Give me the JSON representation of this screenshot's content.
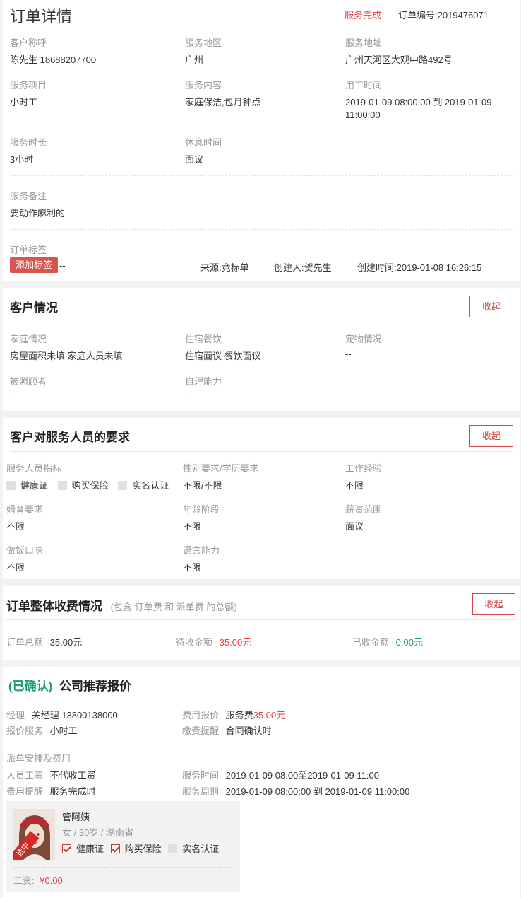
{
  "order": {
    "page_title": "订单详情",
    "status": "服务完成",
    "order_no_label": "订单编号:",
    "order_no": "2019476071",
    "fields": {
      "customer_name": {
        "label": "客户称呼",
        "value": "陈先生 18688207700"
      },
      "service_area": {
        "label": "服务地区",
        "value": "广州"
      },
      "service_address": {
        "label": "服务地址",
        "value": "广州天河区大观中路492号"
      },
      "service_item": {
        "label": "服务项目",
        "value": "小时工"
      },
      "service_content": {
        "label": "服务内容",
        "value": "家庭保洁,包月钟点"
      },
      "work_time": {
        "label": "用工时间",
        "value_line1": "2019-01-09 08:00:00 到 2019-01-09",
        "value_line2": "11:00:00"
      },
      "duration": {
        "label": "服务时长",
        "value": "3小时"
      },
      "rest_time": {
        "label": "休息时间",
        "value": "面议"
      },
      "remark": {
        "label": "服务备注",
        "value": "要动作麻利的"
      },
      "tag": {
        "label": "订单标签",
        "button": "添加标签",
        "value": "--"
      }
    },
    "source_label": "来源:",
    "source": "竞标单",
    "creator_label": "创建人:",
    "creator": "贺先生",
    "created_label": "创建时间:",
    "created": "2019-01-08 16:26:15"
  },
  "customer": {
    "title": "客户情况",
    "collapse": "收起",
    "family": {
      "label": "家庭情况",
      "value": "房屋面积未填 家庭人员未填"
    },
    "lodging": {
      "label": "住宿餐饮",
      "value": "住宿面议 餐饮面议"
    },
    "pets": {
      "label": "宠物情况",
      "value": "--"
    },
    "cared": {
      "label": "被照顾者",
      "value": "--"
    },
    "self_care": {
      "label": "自理能力",
      "value": "--"
    }
  },
  "requirements": {
    "title": "客户对服务人员的要求",
    "collapse": "收起",
    "indicators": {
      "label": "服务人员指标",
      "items": [
        "健康证",
        "购买保险",
        "实名认证"
      ]
    },
    "gender_edu": {
      "label": "性别要求/学历要求",
      "value": "不限/不限"
    },
    "experience": {
      "label": "工作经验",
      "value": "不限"
    },
    "marriage": {
      "label": "婚育要求",
      "value": "不限"
    },
    "age": {
      "label": "年龄阶段",
      "value": "不限"
    },
    "salary": {
      "label": "薪资范围",
      "value": "面议"
    },
    "cooking": {
      "label": "做饭口味",
      "value": "不限"
    },
    "language": {
      "label": "语言能力",
      "value": "不限"
    }
  },
  "fees": {
    "title": "订单整体收费情况",
    "subtitle": "(包含 订单费 和 派单费 的总额)",
    "collapse": "收起",
    "total_label": "订单总额",
    "total": "35.00元",
    "pending_label": "待收金额",
    "pending": "35.00元",
    "received_label": "已收金额",
    "received": "0.00元"
  },
  "quote": {
    "confirmed": "(已确认)",
    "title": "公司推荐报价",
    "manager_label": "经理",
    "manager": "关经理 13800138000",
    "fee_quote_label": "费用报价",
    "fee_quote_prefix": "服务费",
    "fee_quote_amount": "35.00元",
    "quote_service_label": "报价服务",
    "quote_service": "小时工",
    "payment_label": "缴费提醒",
    "payment": "合同确认时",
    "dispatch_title": "派单安排及费用",
    "wage_label": "人员工资",
    "wage": "不代收工资",
    "service_time_label": "服务时间",
    "service_time": "2019-01-09 08:00至2019-01-09 11:00",
    "fee_reminder_label": "费用提醒",
    "fee_reminder": "服务完成时",
    "period_label": "服务周期",
    "period": "2019-01-09 08:00:00 到 2019-01-09 11:00:00"
  },
  "worker": {
    "name": "管阿姨",
    "info": "女 / 30岁 / 湖南省",
    "badge": "选中",
    "certs": [
      {
        "label": "健康证",
        "checked": true
      },
      {
        "label": "购买保险",
        "checked": true
      },
      {
        "label": "实名认证",
        "checked": false
      }
    ],
    "wage_label": "工资:",
    "wage": "¥0.00"
  },
  "colors": {
    "accent_red": "#d24848",
    "price_red": "#e04040",
    "confirm_green": "#1a9f6b"
  }
}
